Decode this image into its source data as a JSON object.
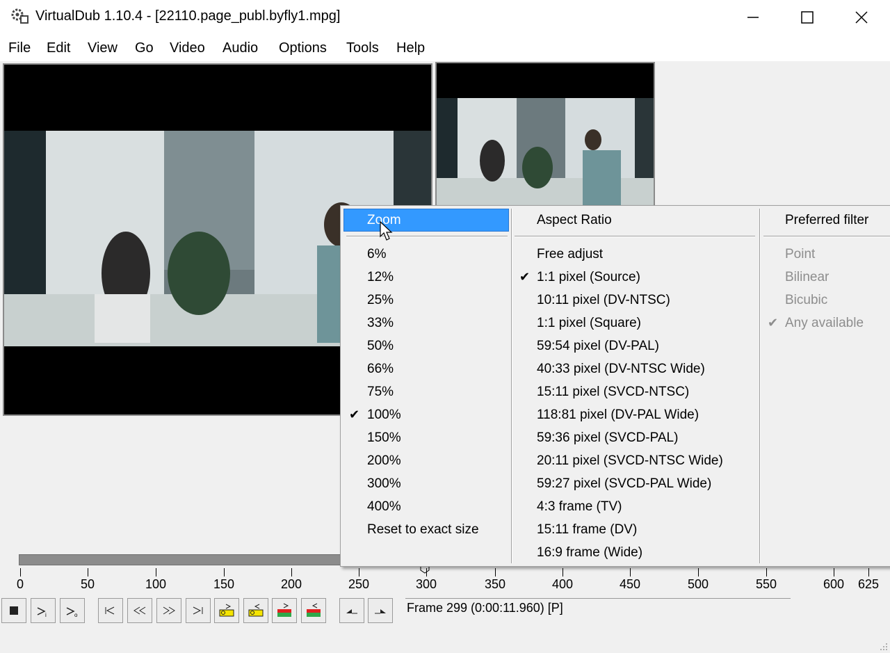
{
  "window": {
    "title": "VirtualDub 1.10.4 - [22110.page_publ.byfly1.mpg]"
  },
  "menubar": [
    "File",
    "Edit",
    "View",
    "Go",
    "Video",
    "Audio",
    "Options",
    "Tools",
    "Help"
  ],
  "popup": {
    "zoom": {
      "header": "Zoom",
      "items": [
        "6%",
        "12%",
        "25%",
        "33%",
        "50%",
        "66%",
        "75%",
        "100%",
        "150%",
        "200%",
        "300%",
        "400%",
        "Reset to exact size"
      ],
      "checked": "100%"
    },
    "aspect": {
      "header": "Aspect Ratio",
      "items": [
        "Free adjust",
        "1:1 pixel (Source)",
        "10:11 pixel (DV-NTSC)",
        "1:1 pixel (Square)",
        "59:54 pixel (DV-PAL)",
        "40:33 pixel (DV-NTSC Wide)",
        "15:11 pixel (SVCD-NTSC)",
        "118:81 pixel (DV-PAL Wide)",
        "59:36 pixel (SVCD-PAL)",
        "20:11 pixel (SVCD-NTSC Wide)",
        "59:27 pixel (SVCD-PAL Wide)",
        "4:3 frame (TV)",
        "15:11 frame (DV)",
        "16:9 frame (Wide)"
      ],
      "checked": "1:1 pixel (Source)"
    },
    "filter": {
      "header": "Preferred filter",
      "items": [
        "Point",
        "Bilinear",
        "Bicubic",
        "Any available"
      ],
      "checked": "Any available"
    }
  },
  "timeline": {
    "ticks": [
      "0",
      "50",
      "100",
      "150",
      "200",
      "250",
      "300",
      "350",
      "400",
      "450",
      "500",
      "550",
      "600",
      "625"
    ],
    "position_frame": 299,
    "total_frames": 625
  },
  "status": {
    "frame": "Frame 299 (0:00:11.960) [P]"
  },
  "toolbar": [
    "stop-icon",
    "play-input-icon",
    "play-output-icon",
    "go-start-icon",
    "prev-frame-icon",
    "next-frame-icon",
    "go-end-icon",
    "prev-key-icon",
    "next-key-icon",
    "prev-scene-icon",
    "next-scene-icon",
    "mark-in-icon",
    "mark-out-icon"
  ]
}
